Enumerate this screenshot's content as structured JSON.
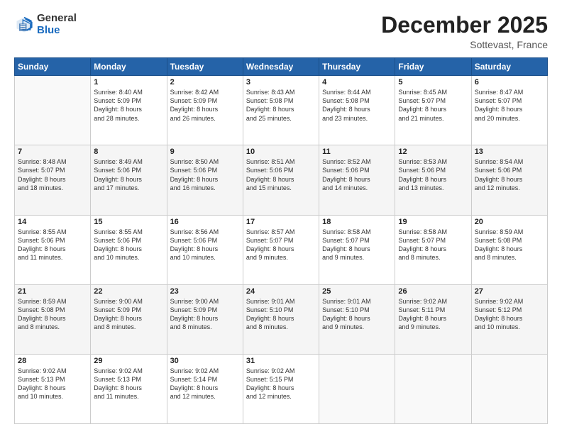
{
  "header": {
    "logo_general": "General",
    "logo_blue": "Blue",
    "month_title": "December 2025",
    "subtitle": "Sottevast, France"
  },
  "days_of_week": [
    "Sunday",
    "Monday",
    "Tuesday",
    "Wednesday",
    "Thursday",
    "Friday",
    "Saturday"
  ],
  "weeks": [
    [
      {
        "day": "",
        "info": ""
      },
      {
        "day": "1",
        "info": "Sunrise: 8:40 AM\nSunset: 5:09 PM\nDaylight: 8 hours\nand 28 minutes."
      },
      {
        "day": "2",
        "info": "Sunrise: 8:42 AM\nSunset: 5:09 PM\nDaylight: 8 hours\nand 26 minutes."
      },
      {
        "day": "3",
        "info": "Sunrise: 8:43 AM\nSunset: 5:08 PM\nDaylight: 8 hours\nand 25 minutes."
      },
      {
        "day": "4",
        "info": "Sunrise: 8:44 AM\nSunset: 5:08 PM\nDaylight: 8 hours\nand 23 minutes."
      },
      {
        "day": "5",
        "info": "Sunrise: 8:45 AM\nSunset: 5:07 PM\nDaylight: 8 hours\nand 21 minutes."
      },
      {
        "day": "6",
        "info": "Sunrise: 8:47 AM\nSunset: 5:07 PM\nDaylight: 8 hours\nand 20 minutes."
      }
    ],
    [
      {
        "day": "7",
        "info": "Sunrise: 8:48 AM\nSunset: 5:07 PM\nDaylight: 8 hours\nand 18 minutes."
      },
      {
        "day": "8",
        "info": "Sunrise: 8:49 AM\nSunset: 5:06 PM\nDaylight: 8 hours\nand 17 minutes."
      },
      {
        "day": "9",
        "info": "Sunrise: 8:50 AM\nSunset: 5:06 PM\nDaylight: 8 hours\nand 16 minutes."
      },
      {
        "day": "10",
        "info": "Sunrise: 8:51 AM\nSunset: 5:06 PM\nDaylight: 8 hours\nand 15 minutes."
      },
      {
        "day": "11",
        "info": "Sunrise: 8:52 AM\nSunset: 5:06 PM\nDaylight: 8 hours\nand 14 minutes."
      },
      {
        "day": "12",
        "info": "Sunrise: 8:53 AM\nSunset: 5:06 PM\nDaylight: 8 hours\nand 13 minutes."
      },
      {
        "day": "13",
        "info": "Sunrise: 8:54 AM\nSunset: 5:06 PM\nDaylight: 8 hours\nand 12 minutes."
      }
    ],
    [
      {
        "day": "14",
        "info": "Sunrise: 8:55 AM\nSunset: 5:06 PM\nDaylight: 8 hours\nand 11 minutes."
      },
      {
        "day": "15",
        "info": "Sunrise: 8:55 AM\nSunset: 5:06 PM\nDaylight: 8 hours\nand 10 minutes."
      },
      {
        "day": "16",
        "info": "Sunrise: 8:56 AM\nSunset: 5:06 PM\nDaylight: 8 hours\nand 10 minutes."
      },
      {
        "day": "17",
        "info": "Sunrise: 8:57 AM\nSunset: 5:07 PM\nDaylight: 8 hours\nand 9 minutes."
      },
      {
        "day": "18",
        "info": "Sunrise: 8:58 AM\nSunset: 5:07 PM\nDaylight: 8 hours\nand 9 minutes."
      },
      {
        "day": "19",
        "info": "Sunrise: 8:58 AM\nSunset: 5:07 PM\nDaylight: 8 hours\nand 8 minutes."
      },
      {
        "day": "20",
        "info": "Sunrise: 8:59 AM\nSunset: 5:08 PM\nDaylight: 8 hours\nand 8 minutes."
      }
    ],
    [
      {
        "day": "21",
        "info": "Sunrise: 8:59 AM\nSunset: 5:08 PM\nDaylight: 8 hours\nand 8 minutes."
      },
      {
        "day": "22",
        "info": "Sunrise: 9:00 AM\nSunset: 5:09 PM\nDaylight: 8 hours\nand 8 minutes."
      },
      {
        "day": "23",
        "info": "Sunrise: 9:00 AM\nSunset: 5:09 PM\nDaylight: 8 hours\nand 8 minutes."
      },
      {
        "day": "24",
        "info": "Sunrise: 9:01 AM\nSunset: 5:10 PM\nDaylight: 8 hours\nand 8 minutes."
      },
      {
        "day": "25",
        "info": "Sunrise: 9:01 AM\nSunset: 5:10 PM\nDaylight: 8 hours\nand 9 minutes."
      },
      {
        "day": "26",
        "info": "Sunrise: 9:02 AM\nSunset: 5:11 PM\nDaylight: 8 hours\nand 9 minutes."
      },
      {
        "day": "27",
        "info": "Sunrise: 9:02 AM\nSunset: 5:12 PM\nDaylight: 8 hours\nand 10 minutes."
      }
    ],
    [
      {
        "day": "28",
        "info": "Sunrise: 9:02 AM\nSunset: 5:13 PM\nDaylight: 8 hours\nand 10 minutes."
      },
      {
        "day": "29",
        "info": "Sunrise: 9:02 AM\nSunset: 5:13 PM\nDaylight: 8 hours\nand 11 minutes."
      },
      {
        "day": "30",
        "info": "Sunrise: 9:02 AM\nSunset: 5:14 PM\nDaylight: 8 hours\nand 12 minutes."
      },
      {
        "day": "31",
        "info": "Sunrise: 9:02 AM\nSunset: 5:15 PM\nDaylight: 8 hours\nand 12 minutes."
      },
      {
        "day": "",
        "info": ""
      },
      {
        "day": "",
        "info": ""
      },
      {
        "day": "",
        "info": ""
      }
    ]
  ]
}
